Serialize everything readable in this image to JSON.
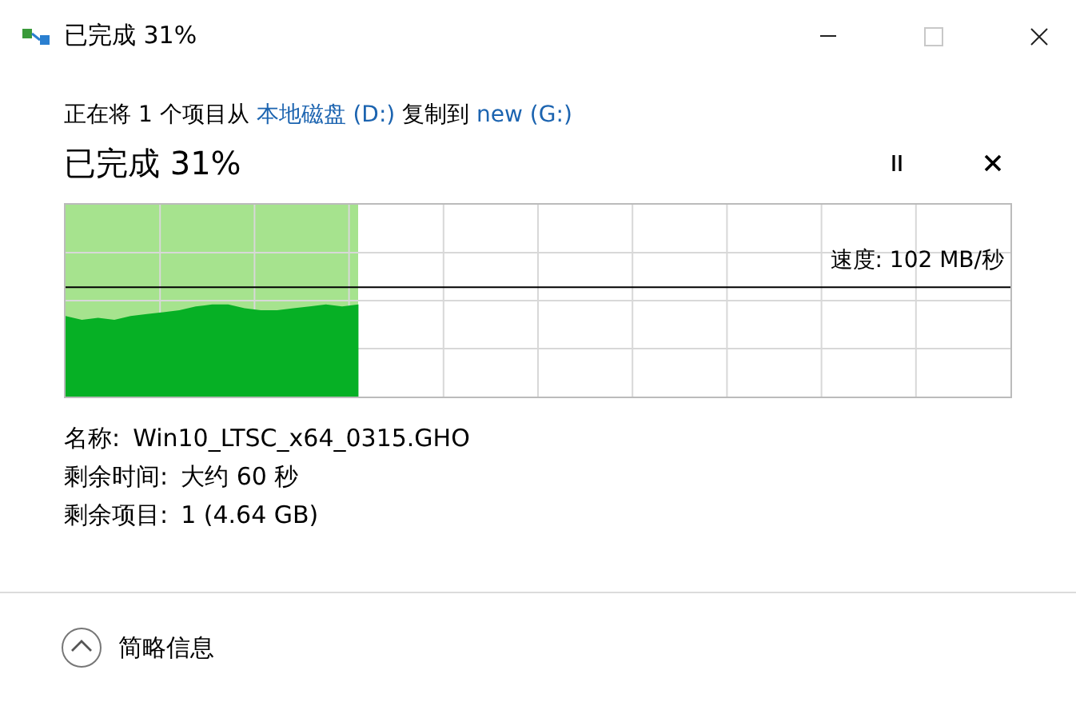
{
  "window": {
    "title": "已完成 31%",
    "buttons": [
      {
        "kind": "minimize",
        "disabled": false
      },
      {
        "kind": "maximize",
        "disabled": true
      },
      {
        "kind": "close",
        "disabled": false
      }
    ]
  },
  "copy_line": {
    "prefix": "正在将 1 个项目从",
    "source": "本地磁盘 (D:)",
    "middle": "复制到",
    "destination": "new (G:)"
  },
  "heading": "已完成 31%",
  "progress": {
    "level": 0.31,
    "speed": "速度: 102 MB/秒"
  },
  "details": [
    {
      "label": "名称:",
      "value": "Win10_LTSC_x64_0315.GHO"
    },
    {
      "label": "剩余时间:",
      "value": "大约 60 秒"
    },
    {
      "label": "剩余项目:",
      "value": "1 (4.64 GB)"
    }
  ],
  "footer": {
    "toggle": "简略信息",
    "expanded": true
  }
}
